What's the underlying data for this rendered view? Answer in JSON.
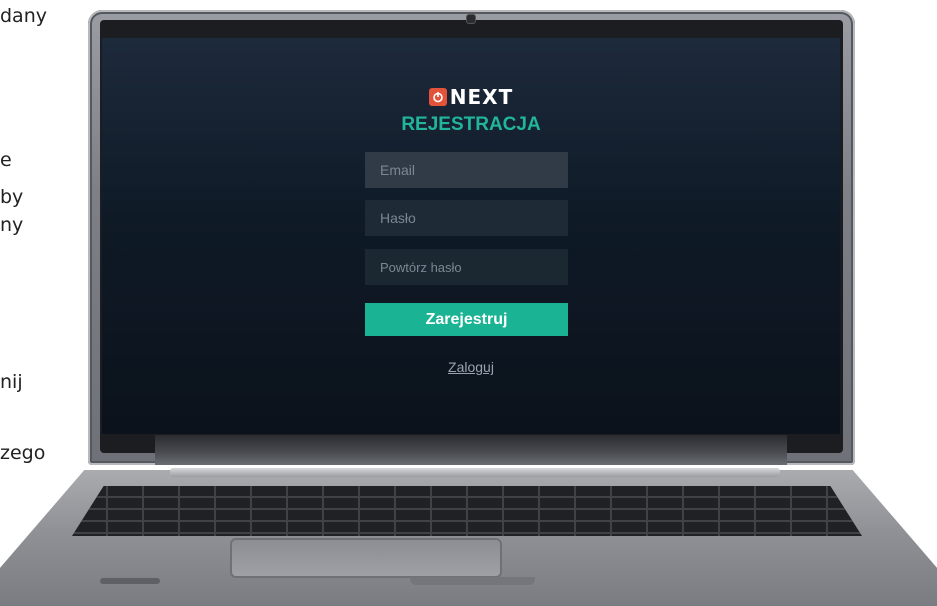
{
  "side_text": {
    "lines": [
      "dany",
      "e",
      "by",
      "ny",
      "nij",
      "zego"
    ]
  },
  "app": {
    "brand": "NEXT",
    "title": "REJESTRACJA"
  },
  "form": {
    "email_placeholder": "Email",
    "password_placeholder": "Hasło",
    "repeat_password_placeholder": "Powtórz hasło",
    "submit_label": "Zarejestruj",
    "login_link": "Zaloguj"
  },
  "colors": {
    "accent": "#1ab394",
    "title": "#21b59b",
    "logo_badge": "#e3533a",
    "screen_bg": "#0f1a27"
  },
  "icons": {
    "logo": "next-logo-icon"
  }
}
